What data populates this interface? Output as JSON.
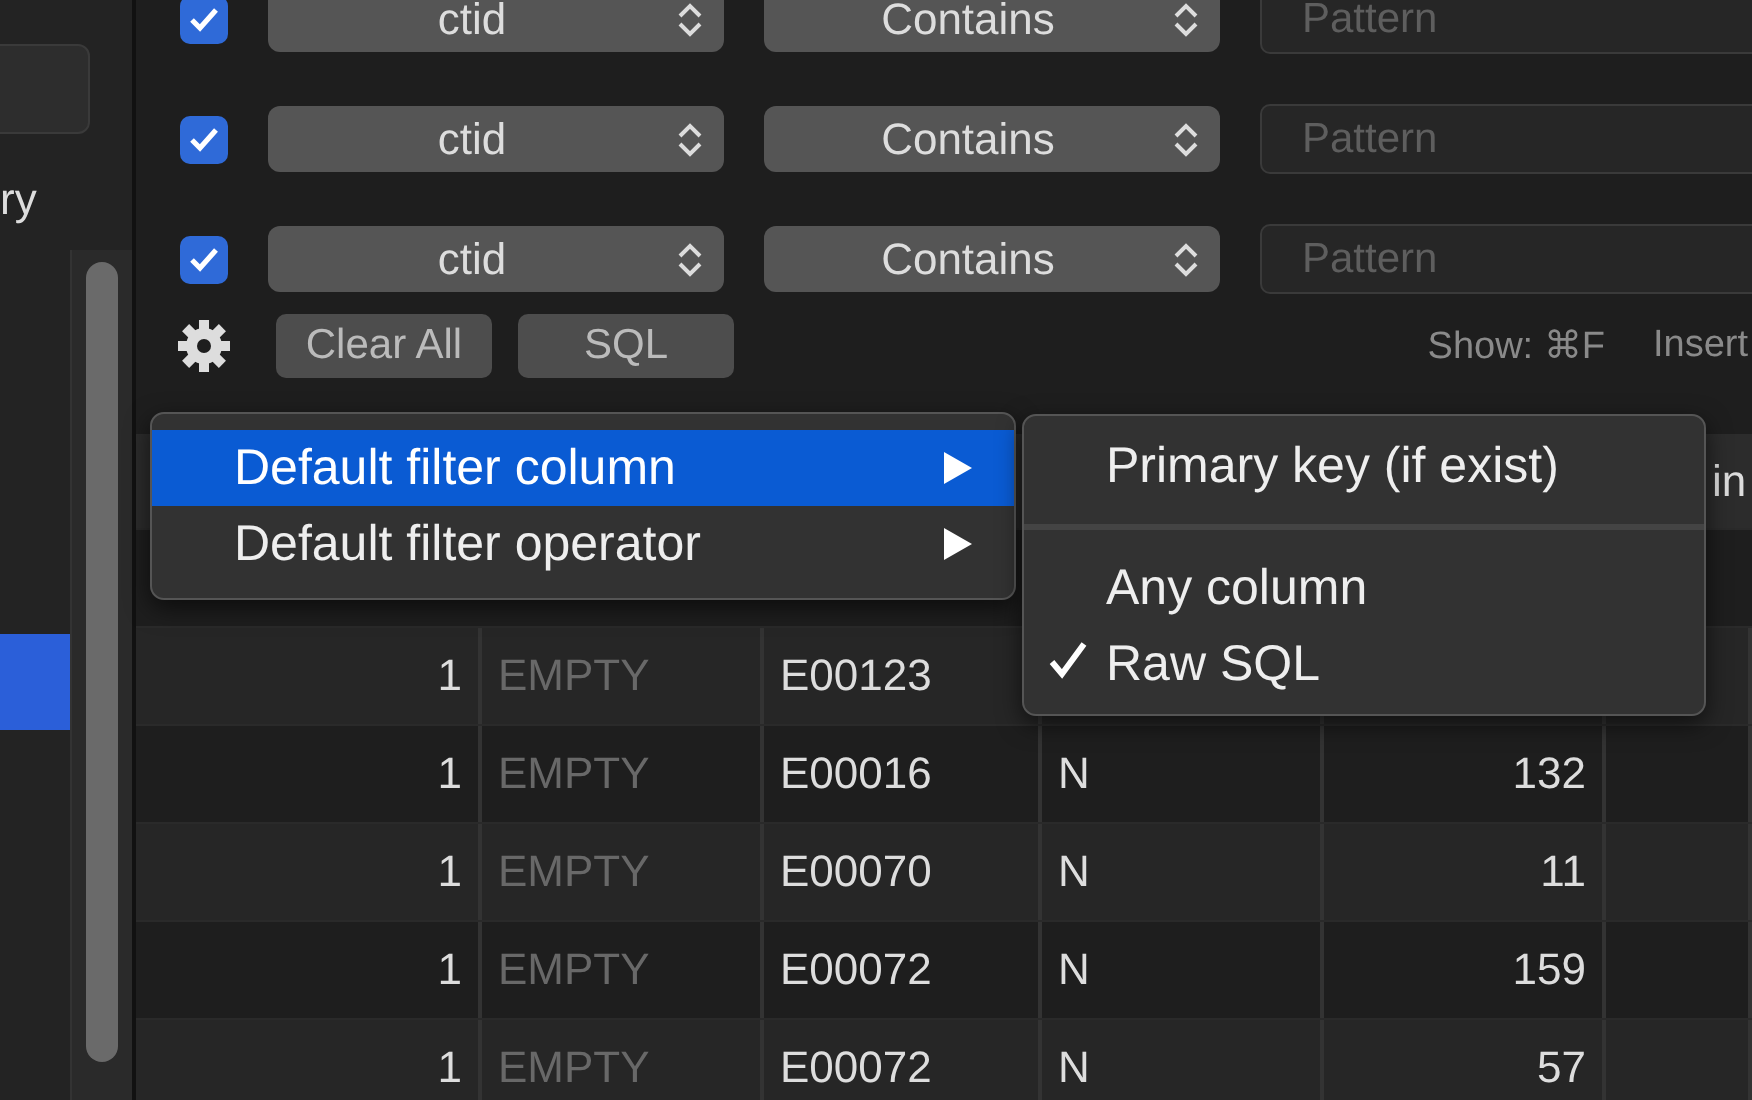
{
  "sidebar": {
    "label": "ry",
    "rows": [
      {
        "selected": false
      },
      {
        "selected": false
      },
      {
        "selected": false
      },
      {
        "selected": false
      },
      {
        "selected": true
      },
      {
        "selected": false
      },
      {
        "selected": false
      },
      {
        "selected": false
      },
      {
        "selected": false
      }
    ]
  },
  "filters": [
    {
      "checked": true,
      "column": "ctid",
      "operator": "Contains",
      "placeholder": "Pattern"
    },
    {
      "checked": true,
      "column": "ctid",
      "operator": "Contains",
      "placeholder": "Pattern"
    },
    {
      "checked": true,
      "column": "ctid",
      "operator": "Contains",
      "placeholder": "Pattern"
    }
  ],
  "toolbar": {
    "buttons": [
      "Clear All",
      "SQL"
    ],
    "hint": "Show: ⌘F",
    "insert": "Insert"
  },
  "table": {
    "header": {
      "column_6": "in"
    },
    "rows": [
      {
        "cells": [
          "1",
          "EMPTY",
          "E00123"
        ]
      },
      {
        "cells": [
          "1",
          "EMPTY",
          "E00016",
          "N",
          "132"
        ]
      },
      {
        "cells": [
          "1",
          "EMPTY",
          "E00070",
          "N",
          "11"
        ]
      },
      {
        "cells": [
          "1",
          "EMPTY",
          "E00072",
          "N",
          "159"
        ]
      },
      {
        "cells": [
          "1",
          "EMPTY",
          "E00072",
          "N",
          "57"
        ]
      }
    ]
  },
  "menu": {
    "items": [
      {
        "label": "Default filter column",
        "selected": true
      },
      {
        "label": "Default filter operator",
        "selected": false
      }
    ]
  },
  "submenu": {
    "items": [
      {
        "kind": "item",
        "label": "Primary key (if exist)",
        "checked": false
      },
      {
        "kind": "separator"
      },
      {
        "kind": "item",
        "label": "Any column",
        "checked": false
      },
      {
        "kind": "item",
        "label": "Raw SQL",
        "checked": true
      }
    ]
  }
}
